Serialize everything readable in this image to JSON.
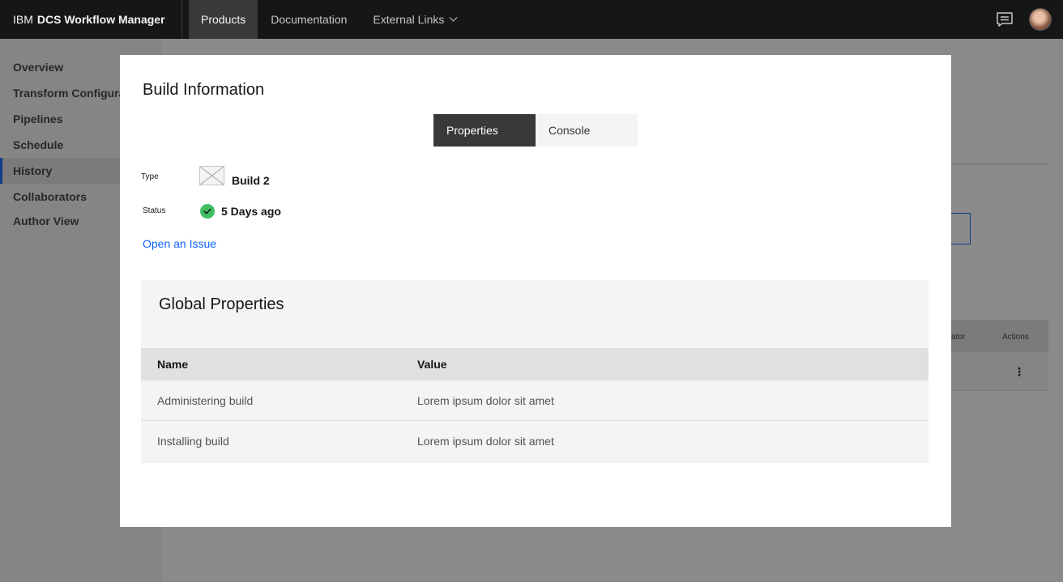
{
  "nav": {
    "brand_prefix": "IBM",
    "brand_name": "DCS Workflow Manager",
    "items": [
      {
        "label": "Products"
      },
      {
        "label": "Documentation"
      },
      {
        "label": "External Links"
      }
    ],
    "chat_icon": "chat-icon",
    "avatar_icon": "user-avatar"
  },
  "sidebar": {
    "items": [
      {
        "label": "Overview"
      },
      {
        "label": "Transform Configuration"
      },
      {
        "label": "Pipelines"
      },
      {
        "label": "Schedule"
      },
      {
        "label": "History"
      },
      {
        "label": "Collaborators"
      },
      {
        "label": "Author View"
      }
    ]
  },
  "background_table": {
    "col_partial": "ator",
    "col_actions": "Actions",
    "kebab": "⋮"
  },
  "modal": {
    "title": "Build Information",
    "tabs": [
      {
        "label": "Properties",
        "selected": true
      },
      {
        "label": "Console",
        "selected": false
      }
    ],
    "type_label": "Type",
    "type_value": "Build 2",
    "status_label": "Status",
    "status_value": "5 Days ago",
    "status_color": "#42be65",
    "issue_link": "Open an Issue",
    "global": {
      "title": "Global Properties",
      "headers": [
        "Name",
        "Value"
      ],
      "rows": [
        [
          "Administering build",
          "Lorem ipsum dolor sit amet"
        ],
        [
          "Installing build",
          "Lorem ipsum dolor sit amet"
        ]
      ]
    }
  },
  "colors": {
    "accent": "#0f62fe",
    "nav_bg": "#161616"
  }
}
